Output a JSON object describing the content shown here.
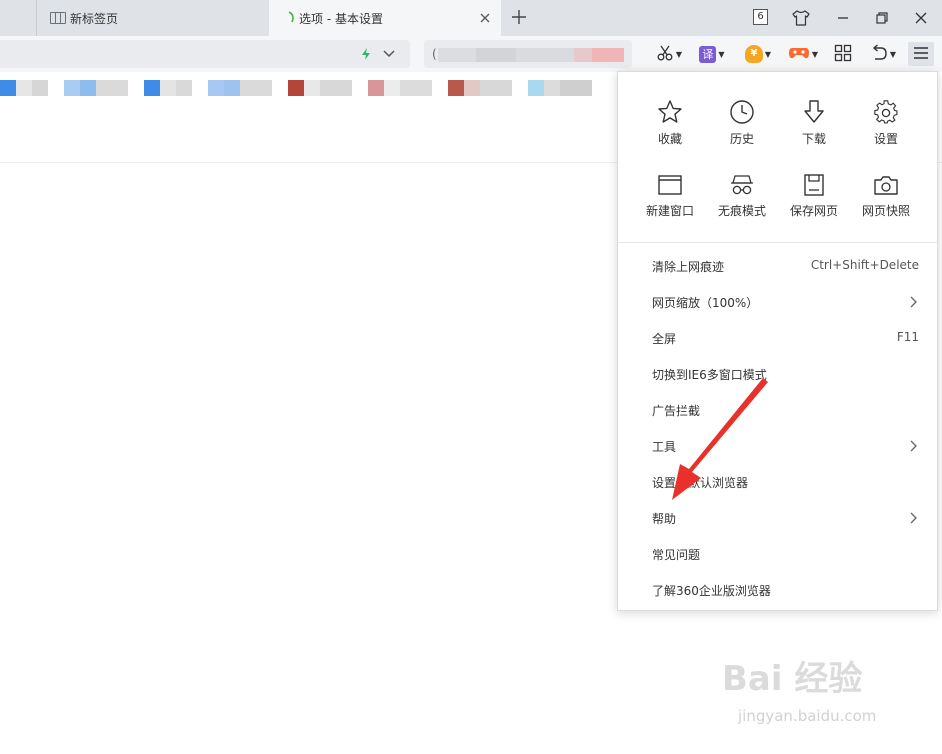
{
  "tabs": [
    {
      "title": "新标签页",
      "state": "inactive",
      "icon": "grid-page-icon"
    },
    {
      "title": "选项 - 基本设置",
      "state": "active",
      "icon": "leaf-icon"
    }
  ],
  "tab_count": "6",
  "window_controls": [
    "skin-icon",
    "minimize-icon",
    "restore-icon",
    "close-icon"
  ],
  "address_bar": {
    "value": "",
    "accelerator_icon": "lightning-icon"
  },
  "search_box": {
    "value": "("
  },
  "toolbar_buttons": [
    "scissors-icon",
    "translate-icon",
    "wallet-icon",
    "game-icon",
    "apps-icon",
    "undo-icon",
    "menu-icon"
  ],
  "translate_label": "译",
  "wallet_label": "¥",
  "menu": {
    "grid": [
      {
        "label": "收藏",
        "icon": "star-icon"
      },
      {
        "label": "历史",
        "icon": "clock-icon"
      },
      {
        "label": "下载",
        "icon": "download-icon"
      },
      {
        "label": "设置",
        "icon": "gear-icon"
      },
      {
        "label": "新建窗口",
        "icon": "window-icon"
      },
      {
        "label": "无痕模式",
        "icon": "incognito-icon"
      },
      {
        "label": "保存网页",
        "icon": "save-icon"
      },
      {
        "label": "网页快照",
        "icon": "camera-icon"
      }
    ],
    "items": [
      {
        "label": "清除上网痕迹",
        "shortcut": "Ctrl+Shift+Delete",
        "submenu": false
      },
      {
        "label": "网页缩放（100%）",
        "shortcut": "",
        "submenu": true
      },
      {
        "label": "全屏",
        "shortcut": "F11",
        "submenu": false
      },
      {
        "label": "切换到IE6多窗口模式",
        "shortcut": "",
        "submenu": false
      },
      {
        "label": "广告拦截",
        "shortcut": "",
        "submenu": false
      },
      {
        "label": "工具",
        "shortcut": "",
        "submenu": true
      },
      {
        "label": "设置为默认浏览器",
        "shortcut": "",
        "submenu": false
      },
      {
        "label": "帮助",
        "shortcut": "",
        "submenu": true
      },
      {
        "label": "常见问题",
        "shortcut": "",
        "submenu": false
      },
      {
        "label": "了解360企业版浏览器",
        "shortcut": "",
        "submenu": false
      }
    ]
  },
  "watermark": {
    "text": "Bai 经验",
    "url": "jingyan.baidu.com"
  },
  "colors": {
    "accent_red": "#e8312a",
    "tab_bar": "#dfe3e8",
    "toolbar": "#f5f6f7"
  }
}
